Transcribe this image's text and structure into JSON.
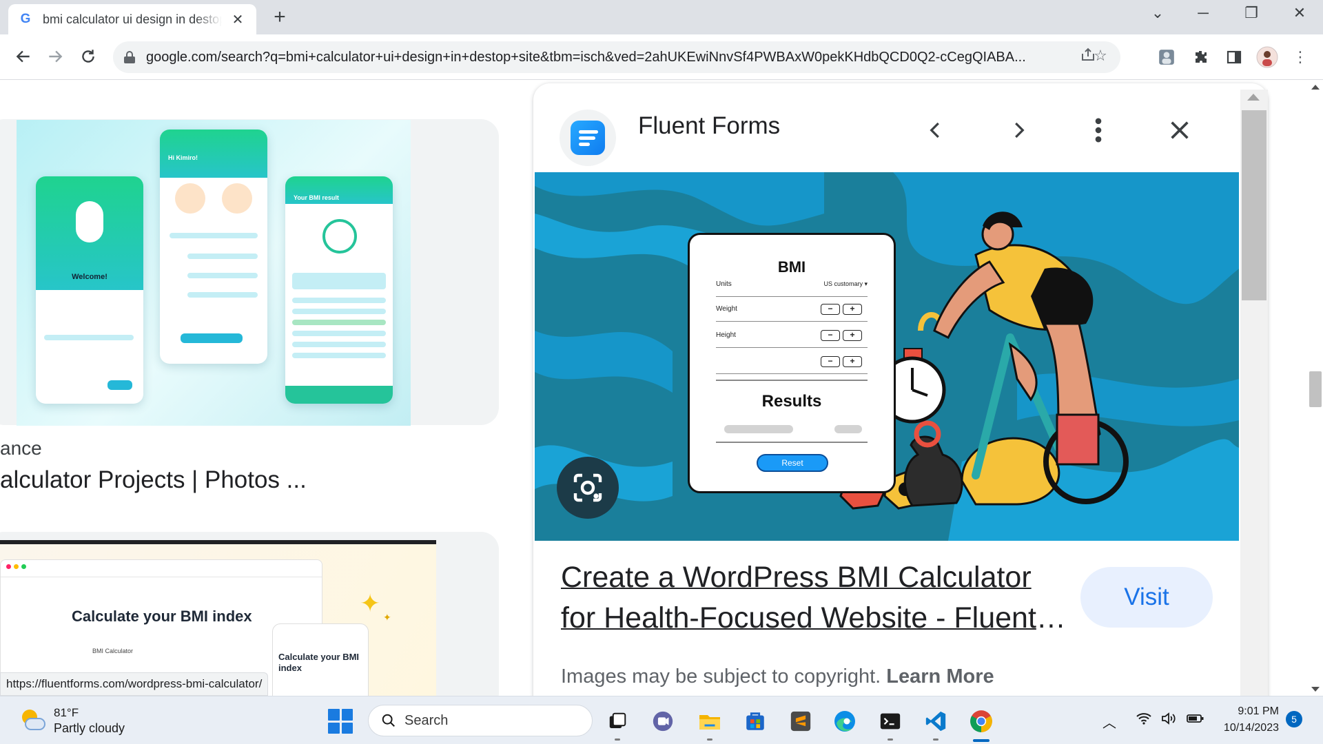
{
  "browser": {
    "tab_title": "bmi calculator ui design in destop site - Google Search",
    "favicon_letter": "G",
    "url": "google.com/search?q=bmi+calculator+ui+design+in+destop+site&tbm=isch&ved=2ahUKEwiNnvSf4PWBAxW0pekKHdbQCD0Q2-cCegQIABA...",
    "status_url": "https://fluentforms.com/wordpress-bmi-calculator/"
  },
  "results": {
    "item1": {
      "source": "ance",
      "title": "alculator Projects | Photos ...",
      "phone_texts": {
        "welcome": "Welcome!",
        "hi": "Hi Kimiro!",
        "your_result": "Your BMI result"
      }
    },
    "item2": {
      "heading": "Calculate your BMI index",
      "subtitle": "BMI Calculator",
      "phone_text": "Calculate your BMI index"
    }
  },
  "panel": {
    "site_name": "Fluent Forms",
    "form": {
      "title": "BMI",
      "units_label": "Units",
      "units_value": "US customary ▾",
      "weight_label": "Weight",
      "height_label": "Height",
      "results_label": "Results",
      "reset_label": "Reset"
    },
    "title_line1": "Create a WordPress BMI Calculator",
    "title_line2": "for Health-Focused Website - Fluent Forms",
    "visit_label": "Visit",
    "copyright_text": "Images may be subject to copyright.",
    "learn_more": "Learn More"
  },
  "taskbar": {
    "weather_temp": "81°F",
    "weather_desc": "Partly cloudy",
    "search_label": "Search",
    "time": "9:01 PM",
    "date": "10/14/2023",
    "notification_count": "5"
  }
}
